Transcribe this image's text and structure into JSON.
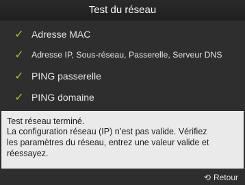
{
  "dialog": {
    "title": "Test du réseau"
  },
  "checks": [
    {
      "label": "Adresse MAC",
      "icon": "checkmark-icon",
      "status": "passed"
    },
    {
      "label": "Adresse IP, Sous-réseau, Passerelle, Serveur DNS",
      "icon": "checkmark-icon",
      "status": "passed"
    },
    {
      "label": "PING passerelle",
      "icon": "checkmark-icon",
      "status": "passed"
    },
    {
      "label": "PING domaine",
      "icon": "checkmark-icon",
      "status": "passed"
    }
  ],
  "message": {
    "lines": [
      "Test réseau terminé.",
      "La configuration réseau (IP) n’est pas valide. Vérifiez",
      "les paramètres du réseau, entrez une valeur valide et",
      "réessayez."
    ]
  },
  "footer": {
    "back_label": "Retour",
    "back_icon": "return-icon"
  },
  "colors": {
    "background": "#2e2e2e",
    "check": "#9bc62a",
    "panel": "#eaeaea"
  }
}
